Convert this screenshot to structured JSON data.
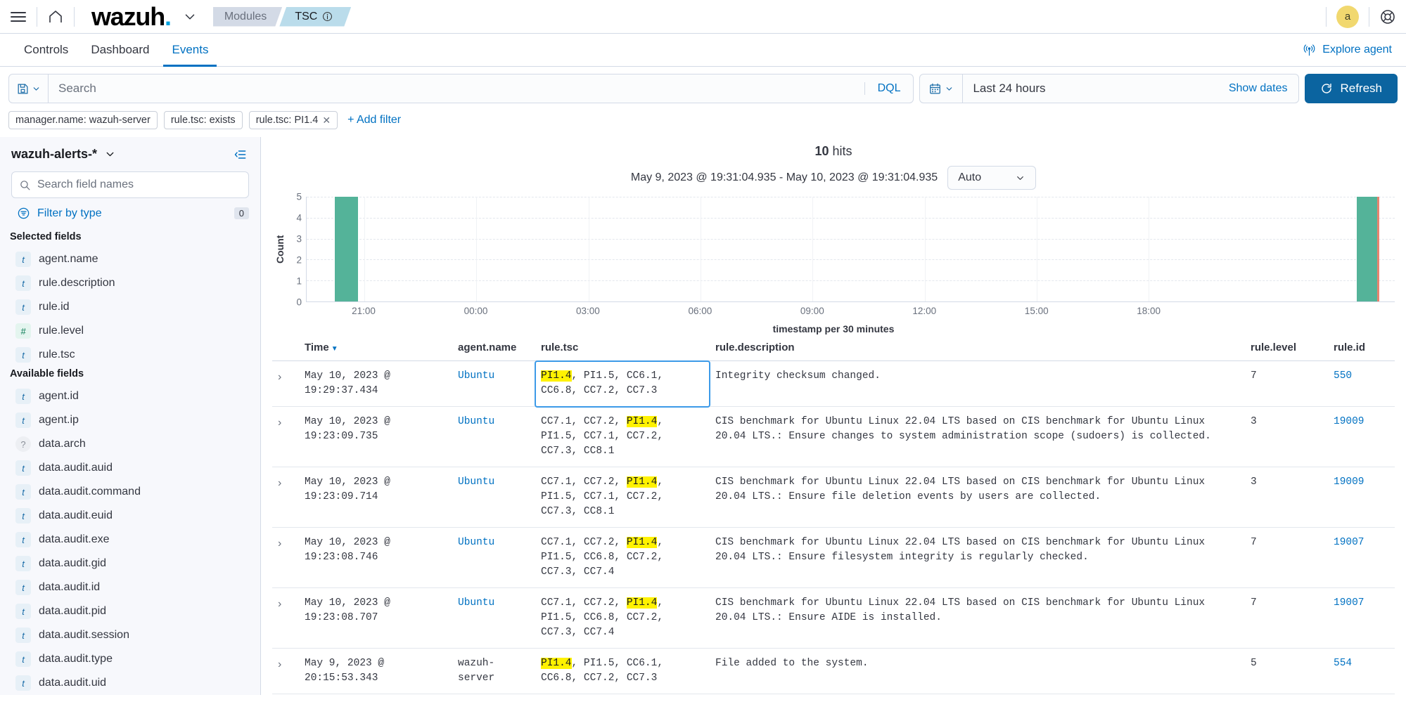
{
  "header": {
    "menu_icon": "hamburger-icon",
    "home_icon": "home-icon",
    "logo_text": "wazuh",
    "logo_dot": ".",
    "breadcrumbs": [
      {
        "label": "Modules",
        "active": false
      },
      {
        "label": "TSC",
        "active": true,
        "info_icon": "info-icon"
      }
    ],
    "avatar_initial": "a",
    "help_icon": "help-lifebuoy-icon"
  },
  "tabs": [
    {
      "label": "Controls",
      "active": false
    },
    {
      "label": "Dashboard",
      "active": false
    },
    {
      "label": "Events",
      "active": true
    }
  ],
  "explore_agent": {
    "label": "Explore agent",
    "icon": "broadcast-icon"
  },
  "query": {
    "saved_query_icon": "save-disk-icon",
    "search_placeholder": "Search",
    "search_value": "",
    "dql_label": "DQL",
    "calendar_icon": "calendar-icon",
    "time_range": "Last 24 hours",
    "show_dates_label": "Show dates",
    "refresh_label": "Refresh",
    "refresh_icon": "refresh-icon",
    "refresh_color": "#0b64a0"
  },
  "filters": {
    "pills": [
      {
        "label": "manager.name: wazuh-server",
        "removable": false
      },
      {
        "label": "rule.tsc: exists",
        "removable": false
      },
      {
        "label": "rule.tsc: PI1.4",
        "removable": true,
        "remove_icon": "close-icon"
      }
    ],
    "add_filter_label": "+ Add filter"
  },
  "sidebar": {
    "index_pattern": "wazuh-alerts-*",
    "chevron_icon": "chevron-down-icon",
    "collapse_icon": "collapse-panel-icon",
    "search_placeholder": "Search field names",
    "search_value": "",
    "search_icon": "search-icon",
    "filter_by_type_label": "Filter by type",
    "filter_by_type_icon": "filter-icon",
    "filter_by_type_count": "0",
    "selected_fields_label": "Selected fields",
    "selected_fields": [
      {
        "name": "agent.name",
        "type": "t"
      },
      {
        "name": "rule.description",
        "type": "t"
      },
      {
        "name": "rule.id",
        "type": "t"
      },
      {
        "name": "rule.level",
        "type": "#"
      },
      {
        "name": "rule.tsc",
        "type": "t"
      }
    ],
    "available_fields_label": "Available fields",
    "available_fields": [
      {
        "name": "agent.id",
        "type": "t"
      },
      {
        "name": "agent.ip",
        "type": "t"
      },
      {
        "name": "data.arch",
        "type": "?"
      },
      {
        "name": "data.audit.auid",
        "type": "t"
      },
      {
        "name": "data.audit.command",
        "type": "t"
      },
      {
        "name": "data.audit.euid",
        "type": "t"
      },
      {
        "name": "data.audit.exe",
        "type": "t"
      },
      {
        "name": "data.audit.gid",
        "type": "t"
      },
      {
        "name": "data.audit.id",
        "type": "t"
      },
      {
        "name": "data.audit.pid",
        "type": "t"
      },
      {
        "name": "data.audit.session",
        "type": "t"
      },
      {
        "name": "data.audit.type",
        "type": "t"
      },
      {
        "name": "data.audit.uid",
        "type": "t"
      }
    ]
  },
  "results": {
    "hits_count": "10",
    "hits_label": "hits",
    "time_range_text": "May 9, 2023 @ 19:31:04.935 - May 10, 2023 @ 19:31:04.935",
    "interval_value": "Auto",
    "interval_chevron": "chevron-down-icon"
  },
  "chart_data": {
    "type": "bar",
    "title": "",
    "xlabel": "timestamp per 30 minutes",
    "ylabel": "Count",
    "ylim": [
      0,
      5
    ],
    "yticks": [
      0,
      1,
      2,
      3,
      4,
      5
    ],
    "xticks": [
      "21:00",
      "00:00",
      "03:00",
      "06:00",
      "09:00",
      "12:00",
      "15:00",
      "18:00"
    ],
    "xtick_positions_pct": [
      5.3,
      15.6,
      25.9,
      36.2,
      46.5,
      56.8,
      67.1,
      77.4
    ],
    "bar_color": "#54B399",
    "edge_color": "#E7846F",
    "grid": true,
    "categories": [
      "20:15",
      "19:15"
    ],
    "values": [
      5,
      5
    ],
    "bars": [
      {
        "x_pct": 2.6,
        "width_pct": 2.1,
        "value": 5,
        "edge": false
      },
      {
        "x_pct": 96.5,
        "width_pct": 2.1,
        "value": 5,
        "edge": true
      }
    ]
  },
  "table": {
    "columns": [
      {
        "key": "time",
        "label": "Time",
        "sorted": true,
        "sort_icon": "sort-desc-icon"
      },
      {
        "key": "agent",
        "label": "agent.name"
      },
      {
        "key": "tsc",
        "label": "rule.tsc"
      },
      {
        "key": "desc",
        "label": "rule.description"
      },
      {
        "key": "level",
        "label": "rule.level"
      },
      {
        "key": "id",
        "label": "rule.id"
      }
    ],
    "expand_icon": "chevron-right-icon",
    "highlight_term": "PI1.4",
    "rows": [
      {
        "time": "May 10, 2023 @ 19:29:37.434",
        "agent": "Ubuntu",
        "agent_link": true,
        "tsc_pre": "",
        "tsc_hl": "PI1.4",
        "tsc_post": ", PI1.5, CC6.1, CC6.8, CC7.2, CC7.3",
        "tsc_selected": true,
        "desc": "Integrity checksum changed.",
        "level": "7",
        "id": "550"
      },
      {
        "time": "May 10, 2023 @ 19:23:09.735",
        "agent": "Ubuntu",
        "agent_link": true,
        "tsc_pre": "CC7.1, CC7.2, ",
        "tsc_hl": "PI1.4",
        "tsc_post": ", PI1.5, CC7.1, CC7.2, CC7.3, CC8.1",
        "tsc_selected": false,
        "desc": "CIS benchmark for Ubuntu Linux 22.04 LTS based on CIS benchmark for Ubuntu Linux 20.04 LTS.: Ensure changes to system administration scope (sudoers) is collected.",
        "level": "3",
        "id": "19009"
      },
      {
        "time": "May 10, 2023 @ 19:23:09.714",
        "agent": "Ubuntu",
        "agent_link": true,
        "tsc_pre": "CC7.1, CC7.2, ",
        "tsc_hl": "PI1.4",
        "tsc_post": ", PI1.5, CC7.1, CC7.2, CC7.3, CC8.1",
        "tsc_selected": false,
        "desc": "CIS benchmark for Ubuntu Linux 22.04 LTS based on CIS benchmark for Ubuntu Linux 20.04 LTS.: Ensure file deletion events by users are collected.",
        "level": "3",
        "id": "19009"
      },
      {
        "time": "May 10, 2023 @ 19:23:08.746",
        "agent": "Ubuntu",
        "agent_link": true,
        "tsc_pre": "CC7.1, CC7.2, ",
        "tsc_hl": "PI1.4",
        "tsc_post": ", PI1.5, CC6.8, CC7.2, CC7.3, CC7.4",
        "tsc_selected": false,
        "desc": "CIS benchmark for Ubuntu Linux 22.04 LTS based on CIS benchmark for Ubuntu Linux 20.04 LTS.: Ensure filesystem integrity is regularly checked.",
        "level": "7",
        "id": "19007"
      },
      {
        "time": "May 10, 2023 @ 19:23:08.707",
        "agent": "Ubuntu",
        "agent_link": true,
        "tsc_pre": "CC7.1, CC7.2, ",
        "tsc_hl": "PI1.4",
        "tsc_post": ", PI1.5, CC6.8, CC7.2, CC7.3, CC7.4",
        "tsc_selected": false,
        "desc": "CIS benchmark for Ubuntu Linux 22.04 LTS based on CIS benchmark for Ubuntu Linux 20.04 LTS.: Ensure AIDE is installed.",
        "level": "7",
        "id": "19007"
      },
      {
        "time": "May 9, 2023 @ 20:15:53.343",
        "agent": "wazuh-server",
        "agent_link": false,
        "tsc_pre": "",
        "tsc_hl": "PI1.4",
        "tsc_post": ", PI1.5, CC6.1, CC6.8, CC7.2, CC7.3",
        "tsc_selected": false,
        "desc": "File added to the system.",
        "level": "5",
        "id": "554"
      }
    ]
  }
}
